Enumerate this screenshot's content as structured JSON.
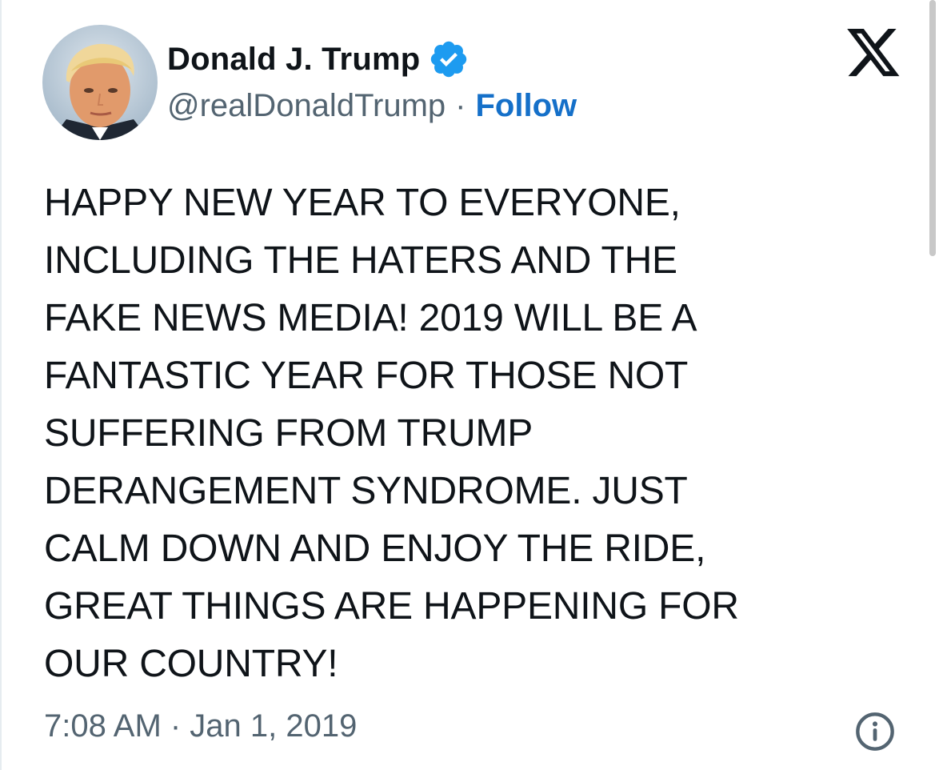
{
  "tweet": {
    "author": {
      "display_name": "Donald J. Trump",
      "handle": "@realDonaldTrump",
      "separator": "·",
      "follow_label": "Follow",
      "verified_icon": "verified-badge-icon",
      "avatar_icon": "profile-photo"
    },
    "platform_icon": "x-logo-icon",
    "text": "HAPPY NEW YEAR TO EVERYONE,\nINCLUDING THE HATERS AND THE\nFAKE NEWS MEDIA! 2019 WILL BE A\nFANTASTIC YEAR FOR THOSE NOT\nSUFFERING FROM TRUMP\nDERANGEMENT SYNDROME. JUST\nCALM DOWN AND ENJOY THE RIDE,\nGREAT THINGS ARE HAPPENING FOR\nOUR COUNTRY!",
    "timestamp": "7:08 AM · Jan 1, 2019",
    "info_icon": "info-icon"
  },
  "colors": {
    "follow": "#1570c9",
    "verified": "#1d9bf0",
    "text": "#0f1419",
    "secondary": "#536471"
  }
}
